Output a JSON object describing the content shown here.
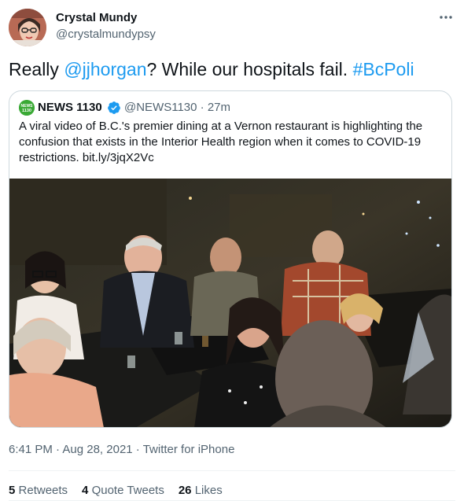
{
  "tweet": {
    "author_name": "Crystal Mundy",
    "author_handle": "@crystalmundypsy",
    "text_prefix": "Really ",
    "mention": "@jjhorgan",
    "text_middle": "? While our hospitals fail. ",
    "hashtag": "#BcPoli",
    "time": "6:41 PM",
    "sep1": " · ",
    "date": "Aug 28, 2021",
    "sep2": " · ",
    "source": "Twitter for iPhone"
  },
  "quote": {
    "avatar_text": "NEWS 1130",
    "name": "NEWS 1130",
    "handle": "@NEWS1130",
    "sep": " · ",
    "age": "27m",
    "text": "A viral video of B.C.'s premier dining at a Vernon restaurant is highlighting the confusion that exists in the Interior Health region when it comes to COVID-19 restrictions. bit.ly/3jqX2Vc"
  },
  "stats": {
    "retweets_count": "5",
    "retweets_label": "Retweets",
    "quotes_count": "4",
    "quotes_label": "Quote Tweets",
    "likes_count": "26",
    "likes_label": "Likes"
  },
  "colors": {
    "link": "#1d9bf0",
    "secondary": "#536471",
    "border": "#cfd9de"
  },
  "icons": {
    "more": "more-horizontal-icon",
    "verified": "verified-badge-icon"
  }
}
